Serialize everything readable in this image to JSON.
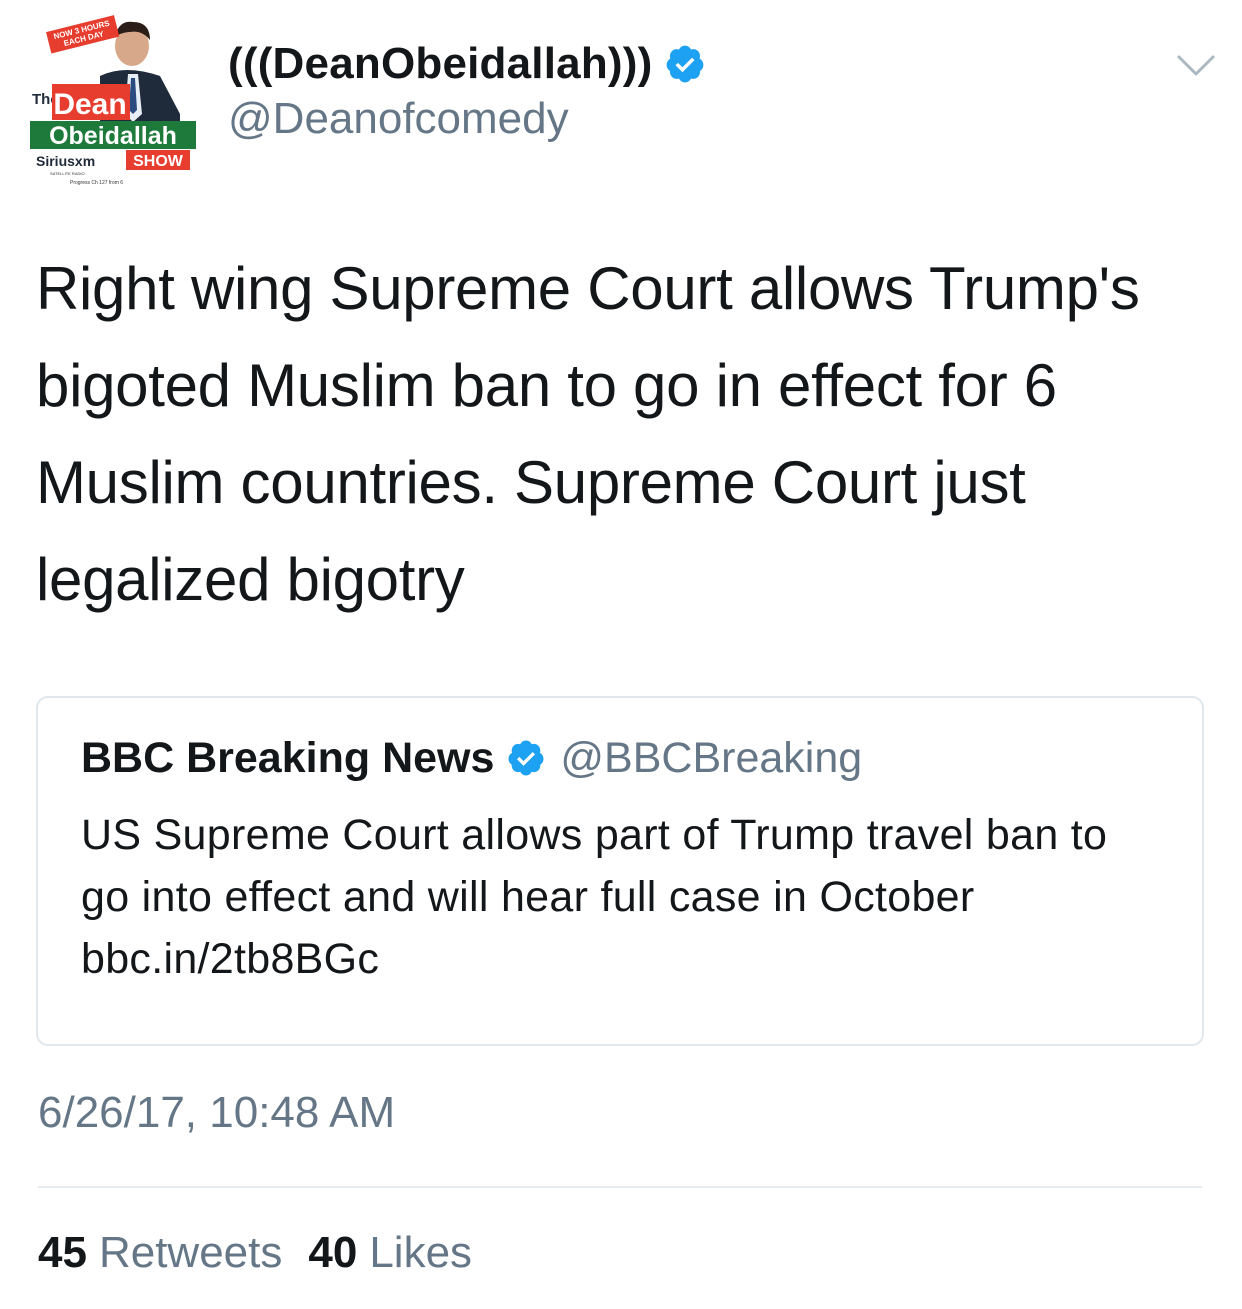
{
  "author": {
    "display_name": "(((DeanObeidallah)))",
    "handle": "@Deanofcomedy",
    "verified_icon": "verified-badge-icon",
    "avatar_text": {
      "banner": "NOW 3 HOURS EACH DAY",
      "the": "The",
      "dean": "Dean",
      "obeidallah": "Obeidallah",
      "sirius": "Siriusxm",
      "satellite": "SATELLITE RADIO",
      "show": "SHOW",
      "progress": "Progress Ch 127 from 6"
    }
  },
  "tweet": {
    "text": "Right wing Supreme Court allows Trump's bigoted Muslim ban to go in effect for 6 Muslim countries. Supreme Court just legalized bigotry",
    "timestamp": "6/26/17, 10:48 AM"
  },
  "quoted_tweet": {
    "display_name": "BBC Breaking News",
    "handle": "@BBCBreaking",
    "text": "US Supreme Court allows part of Trump travel ban to go into effect and will hear full case in October bbc.in/2tb8BGc"
  },
  "stats": {
    "retweets_count": "45",
    "retweets_label": "Retweets",
    "likes_count": "40",
    "likes_label": "Likes"
  },
  "colors": {
    "primary_text": "#14171a",
    "secondary_text": "#657786",
    "verified_blue": "#1da1f2",
    "border": "#e1e8ed",
    "avatar_red": "#e63d2f",
    "avatar_green": "#1e7a3a"
  },
  "icons": {
    "caret": "chevron-down-icon",
    "verified": "verified-badge-icon"
  }
}
